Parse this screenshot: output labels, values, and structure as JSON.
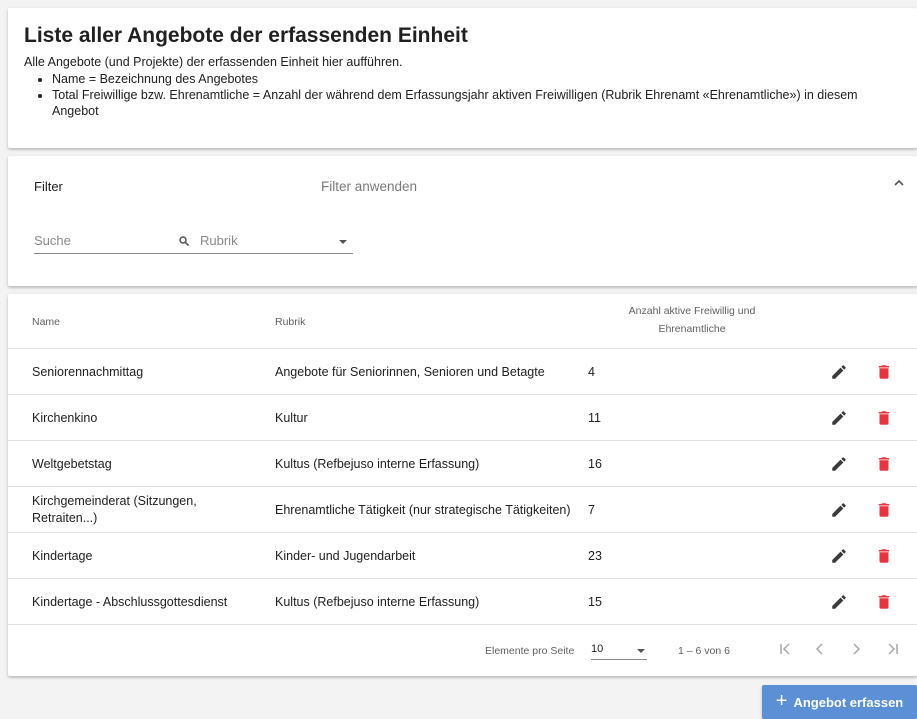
{
  "header": {
    "title": "Liste aller Angebote der erfassenden Einheit",
    "intro": "Alle Angebote (und Projekte) der erfassenden Einheit hier aufführen.",
    "bullets": [
      "Name = Bezeichnung des Angebotes",
      "Total Freiwillige bzw. Ehrenamtliche = Anzahl der während dem Erfassungsjahr aktiven Freiwilligen (Rubrik Ehrenamt «Ehrenamtliche») in diesem Angebot"
    ]
  },
  "filter": {
    "label": "Filter",
    "apply_label": "Filter anwenden",
    "search_placeholder": "Suche",
    "rubrik_placeholder": "Rubrik"
  },
  "table": {
    "columns": {
      "name": "Name",
      "rubrik": "Rubrik",
      "anzahl_line1": "Anzahl aktive Freiwillig und",
      "anzahl_line2": "Ehrenamtliche"
    },
    "rows": [
      {
        "name": "Seniorennachmittag",
        "rubrik": "Angebote für Seniorinnen, Senioren und Betagte",
        "anzahl": "4"
      },
      {
        "name": "Kirchenkino",
        "rubrik": "Kultur",
        "anzahl": "11"
      },
      {
        "name": "Weltgebetstag",
        "rubrik": "Kultus (Refbejuso interne Erfassung)",
        "anzahl": "16"
      },
      {
        "name": "Kirchgemeinderat (Sitzungen, Retraiten...)",
        "rubrik": "Ehrenamtliche Tätigkeit (nur strategische Tätigkeiten)",
        "anzahl": "7"
      },
      {
        "name": "Kindertage",
        "rubrik": "Kinder- und Jugendarbeit",
        "anzahl": "23"
      },
      {
        "name": "Kindertage - Abschlussgottesdienst",
        "rubrik": "Kultus (Refbejuso interne Erfassung)",
        "anzahl": "15"
      }
    ]
  },
  "paginator": {
    "per_page_label": "Elemente pro Seite",
    "per_page_value": "10",
    "range_label": "1 – 6 von 6"
  },
  "actions": {
    "add_label": "Angebot erfassen",
    "add_icon": "+"
  },
  "colors": {
    "accent": "#5b8fd6",
    "delete": "#e8343f",
    "edit": "#3a3a3a"
  },
  "icons": {
    "edit": "pencil-icon",
    "delete": "trash-icon",
    "search": "search-icon",
    "collapse": "chevron-up-icon"
  }
}
